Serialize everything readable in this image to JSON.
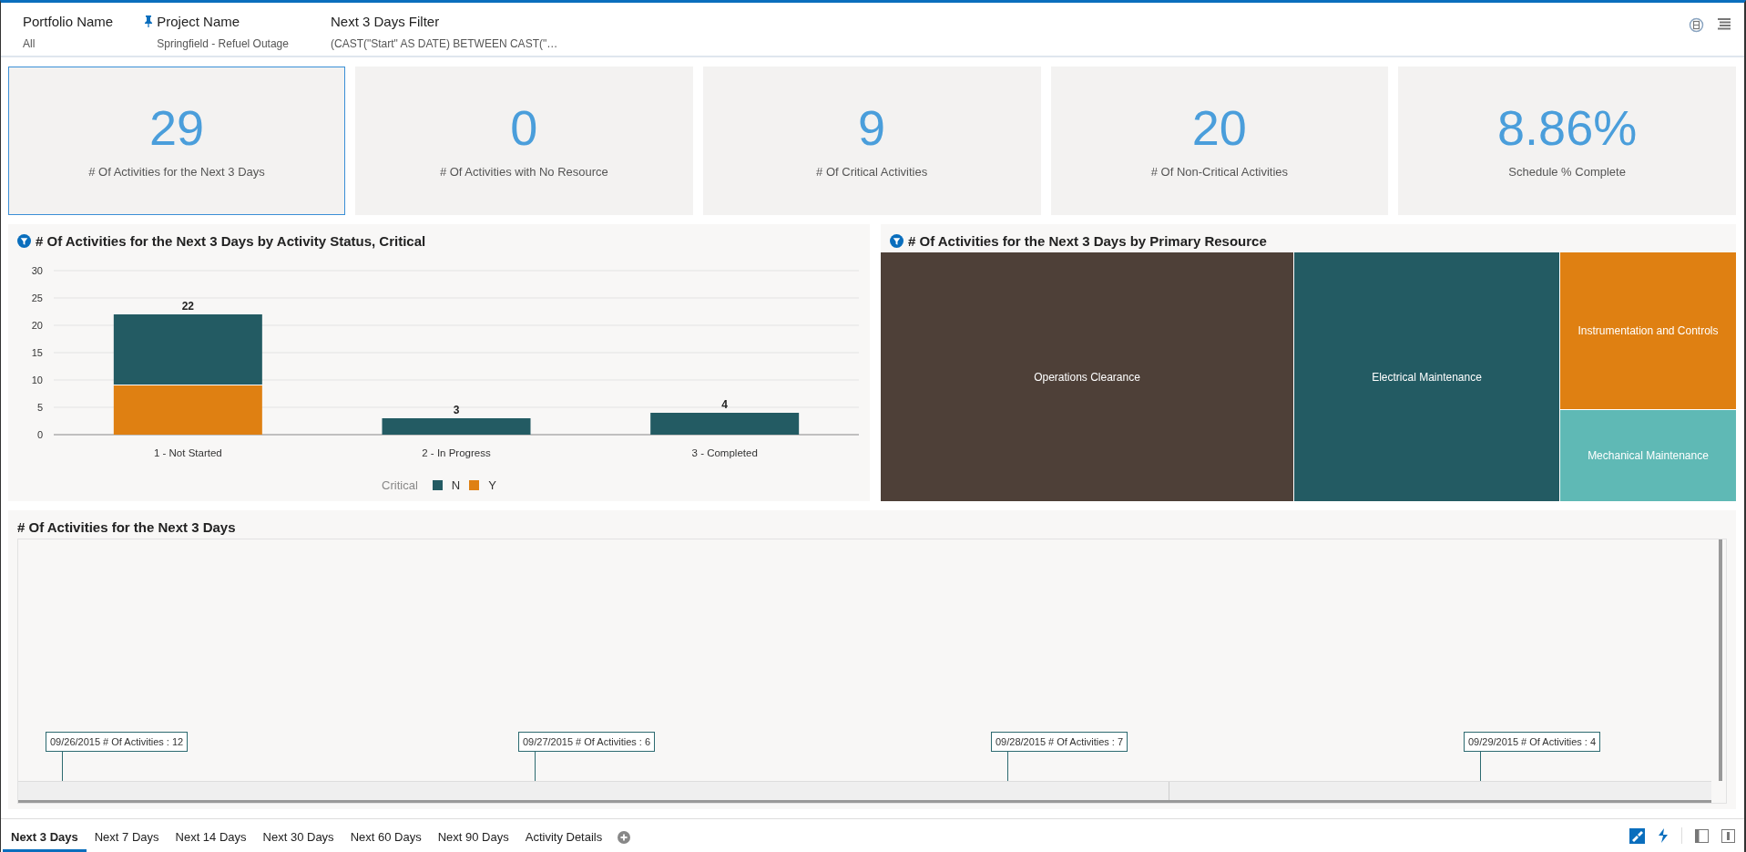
{
  "filters": [
    {
      "label": "Portfolio Name",
      "value": "All",
      "pinned": false
    },
    {
      "label": "Project Name",
      "value": "Springfield - Refuel Outage",
      "pinned": true
    },
    {
      "label": "Next 3 Days Filter",
      "value": "(CAST(\"Start\" AS DATE) BETWEEN CAST(\"…",
      "pinned": false
    }
  ],
  "kpis": [
    {
      "value": "29",
      "label": "# Of Activities for the Next 3 Days",
      "selected": true
    },
    {
      "value": "0",
      "label": "# Of Activities with No Resource",
      "selected": false
    },
    {
      "value": "9",
      "label": "# Of Critical Activities",
      "selected": false
    },
    {
      "value": "20",
      "label": "# Of Non-Critical Activities",
      "selected": false
    },
    {
      "value": "8.86%",
      "label": "Schedule % Complete",
      "selected": false
    }
  ],
  "status_chart": {
    "title": "# Of Activities for the Next 3 Days by Activity Status, Critical",
    "chart_data": {
      "type": "bar",
      "stacked": true,
      "categories": [
        "1 - Not Started",
        "2 - In Progress",
        "3 - Completed"
      ],
      "series": [
        {
          "name": "Y",
          "color": "#df8012",
          "values": [
            9,
            null,
            null
          ]
        },
        {
          "name": "N",
          "color": "#235b63",
          "values": [
            13,
            3,
            4
          ]
        }
      ],
      "ylim": [
        0,
        30
      ],
      "grid": true,
      "yticks": [
        0,
        5,
        10,
        15,
        20,
        25,
        30
      ],
      "value_labels": [
        "22",
        "3",
        "4"
      ],
      "legend_title": "Critical"
    }
  },
  "resource_chart": {
    "title": "# Of Activities for the Next 3 Days by Primary Resource",
    "tiles": [
      {
        "label": "Operations Clearance",
        "color": "#4e4038"
      },
      {
        "label": "Electrical Maintenance",
        "color": "#235b63"
      },
      {
        "label": "Instrumentation and Controls",
        "color": "#df8012"
      },
      {
        "label": "Mechanical Maintenance",
        "color": "#5fb9b5"
      }
    ]
  },
  "timeline": {
    "title": "# Of Activities for the Next 3 Days",
    "events": [
      "09/26/2015 # Of Activities : 12",
      "09/27/2015 # Of Activities : 6",
      "09/28/2015 # Of Activities : 7",
      "09/29/2015 # Of Activities : 4"
    ]
  },
  "tabs": [
    {
      "label": "Next 3 Days",
      "selected": true
    },
    {
      "label": "Next 7 Days",
      "selected": false
    },
    {
      "label": "Next 14 Days",
      "selected": false
    },
    {
      "label": "Next 30 Days",
      "selected": false
    },
    {
      "label": "Next 60 Days",
      "selected": false
    },
    {
      "label": "Next 90 Days",
      "selected": false
    },
    {
      "label": "Activity Details",
      "selected": false
    }
  ]
}
